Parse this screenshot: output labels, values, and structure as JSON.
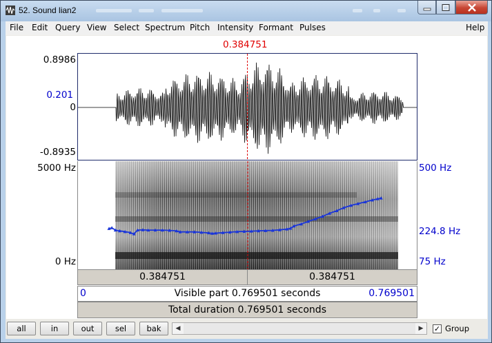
{
  "window": {
    "title": "52. Sound lian2"
  },
  "menu": [
    "File",
    "Edit",
    "Query",
    "View",
    "Select",
    "Spectrum",
    "Pitch",
    "Intensity",
    "Formant",
    "Pulses",
    "Help"
  ],
  "cursor": {
    "time_label": "0.384751",
    "time": 0.384751,
    "color": "#e00000"
  },
  "waveform": {
    "max_label": "0.8986",
    "cursor_value_label": "0.201",
    "zero_label": "0",
    "min_label": "-0.8935",
    "line_color": "#000000"
  },
  "spectrogram": {
    "freq_top_label": "5000 Hz",
    "freq_bottom_label": "0 Hz"
  },
  "pitch": {
    "top_label": "500 Hz",
    "cursor_value_label": "224.8 Hz",
    "bottom_label": "75 Hz",
    "color": "#1a35d9",
    "points": [
      [
        0.0,
        235
      ],
      [
        0.008,
        238
      ],
      [
        0.018,
        229
      ],
      [
        0.03,
        226
      ],
      [
        0.045,
        223
      ],
      [
        0.06,
        219
      ],
      [
        0.07,
        214
      ],
      [
        0.08,
        229
      ],
      [
        0.095,
        230
      ],
      [
        0.11,
        229
      ],
      [
        0.13,
        229
      ],
      [
        0.15,
        229
      ],
      [
        0.17,
        228
      ],
      [
        0.19,
        226
      ],
      [
        0.2,
        222
      ],
      [
        0.22,
        222
      ],
      [
        0.24,
        222
      ],
      [
        0.26,
        220
      ],
      [
        0.28,
        218
      ],
      [
        0.29,
        216
      ],
      [
        0.3,
        217
      ],
      [
        0.32,
        219
      ],
      [
        0.34,
        221
      ],
      [
        0.36,
        223
      ],
      [
        0.38,
        224
      ],
      [
        0.4,
        225
      ],
      [
        0.42,
        226
      ],
      [
        0.44,
        227
      ],
      [
        0.46,
        228
      ],
      [
        0.48,
        230
      ],
      [
        0.5,
        233
      ],
      [
        0.51,
        236
      ],
      [
        0.52,
        245
      ],
      [
        0.54,
        253
      ],
      [
        0.56,
        263
      ],
      [
        0.58,
        273
      ],
      [
        0.6,
        283
      ],
      [
        0.62,
        295
      ],
      [
        0.64,
        305
      ],
      [
        0.66,
        317
      ],
      [
        0.68,
        326
      ],
      [
        0.7,
        333
      ],
      [
        0.72,
        340
      ],
      [
        0.74,
        347
      ],
      [
        0.755,
        352
      ],
      [
        0.765,
        355
      ]
    ]
  },
  "timebar": {
    "left_label": "0.384751",
    "right_label": "0.384751"
  },
  "visible": {
    "start_label": "0",
    "text": "Visible part 0.769501 seconds",
    "end_label": "0.769501",
    "duration": 0.769501
  },
  "total": {
    "text": "Total duration 0.769501 seconds"
  },
  "toolbar": {
    "all_label": "all",
    "in_label": "in",
    "out_label": "out",
    "sel_label": "sel",
    "bak_label": "bak",
    "group_label": "Group",
    "group_checked": true
  }
}
